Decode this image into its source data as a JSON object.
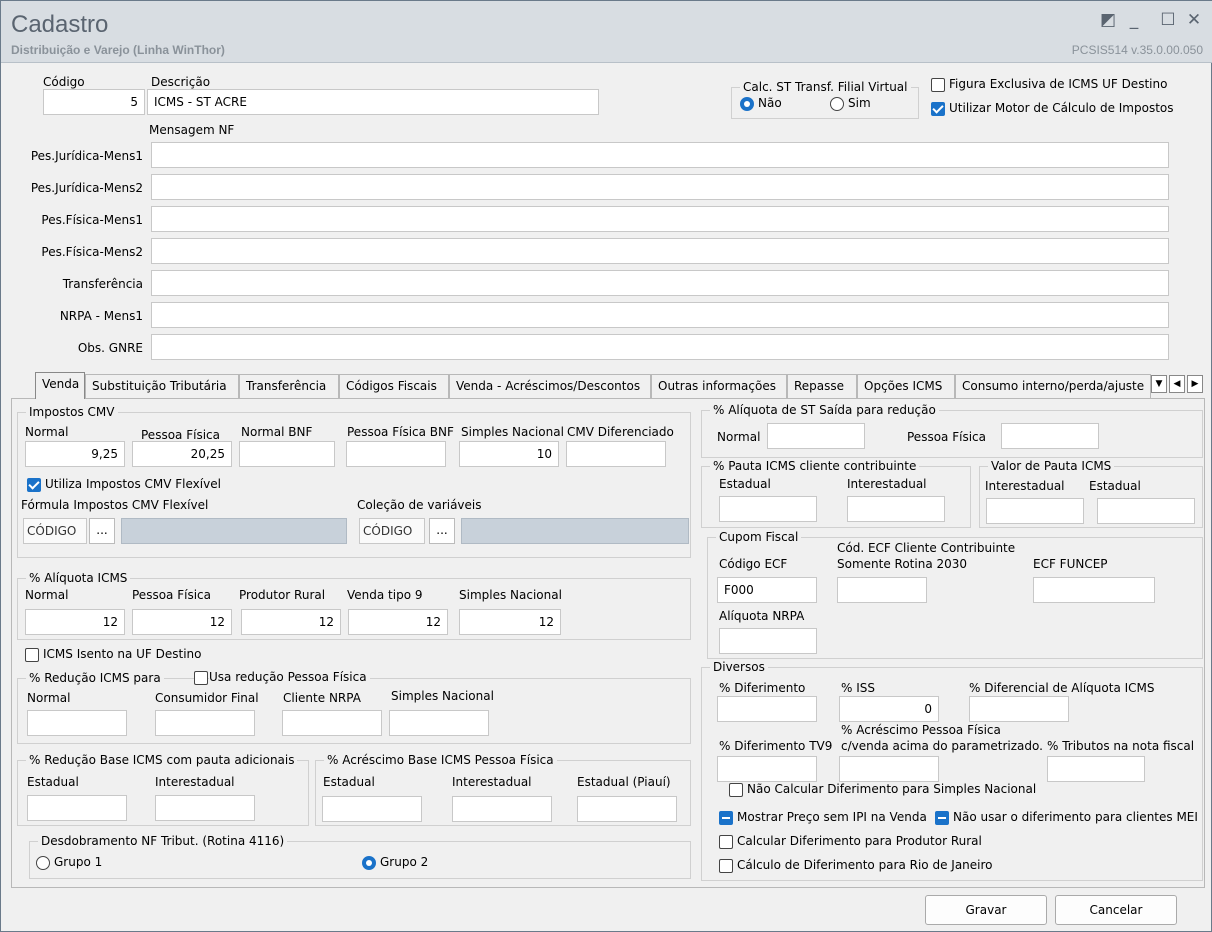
{
  "window": {
    "title": "Cadastro",
    "subtitle": "Distribuição e Varejo (Linha WinThor)",
    "version": "PCSIS514  v.35.0.00.050",
    "controls": {
      "restore": "◩",
      "minimize": "_",
      "maximize": "☐",
      "close": "✕"
    }
  },
  "header": {
    "codigo_label": "Código",
    "codigo_value": "5",
    "descricao_label": "Descrição",
    "descricao_value": "ICMS - ST ACRE",
    "calc_st_label": "Calc. ST Transf. Filial Virtual",
    "calc_st_nao": "Não",
    "calc_st_sim": "Sim",
    "calc_st_selected": "Não",
    "figura_exclusiva_label": "Figura Exclusiva de ICMS UF Destino",
    "figura_exclusiva_checked": false,
    "motor_calculo_label": "Utilizar Motor de Cálculo de Impostos",
    "motor_calculo_checked": true,
    "mensagem_nf_label": "Mensagem NF"
  },
  "messages": [
    {
      "label": "Pes.Jurídica-Mens1",
      "value": ""
    },
    {
      "label": "Pes.Jurídica-Mens2",
      "value": ""
    },
    {
      "label": "Pes.Física-Mens1",
      "value": ""
    },
    {
      "label": "Pes.Física-Mens2",
      "value": ""
    },
    {
      "label": "Transferência",
      "value": ""
    },
    {
      "label": "NRPA - Mens1",
      "value": ""
    },
    {
      "label": "Obs. GNRE",
      "value": ""
    }
  ],
  "tabs": [
    {
      "label": "Venda",
      "active": true
    },
    {
      "label": "Substituição Tributária"
    },
    {
      "label": "Transferência"
    },
    {
      "label": "Códigos Fiscais"
    },
    {
      "label": "Venda - Acréscimos/Descontos"
    },
    {
      "label": "Outras informações"
    },
    {
      "label": "Repasse"
    },
    {
      "label": "Opções ICMS"
    },
    {
      "label": "Consumo interno/perda/ajuste"
    }
  ],
  "tabnav": {
    "down": "▼",
    "left": "◀",
    "right": "▶"
  },
  "impostos_cmv": {
    "title": "Impostos CMV",
    "fields": [
      {
        "label": "Normal",
        "value": "9,25"
      },
      {
        "label": "Pessoa Física",
        "value": "20,25"
      },
      {
        "label": "Normal BNF",
        "value": ""
      },
      {
        "label": "Pessoa Física BNF",
        "value": ""
      },
      {
        "label": "Simples Nacional",
        "value": "10"
      },
      {
        "label": "CMV Diferenciado",
        "value": ""
      }
    ],
    "utiliza_flexivel_label": "Utiliza Impostos CMV Flexível",
    "utiliza_flexivel_checked": true,
    "formula_label": "Fórmula Impostos CMV Flexível",
    "formula_codigo": "CÓDIGO",
    "colecao_label": "Coleção de variáveis",
    "colecao_codigo": "CÓDIGO",
    "ellipsis": "..."
  },
  "aliquota_icms": {
    "title": "% Alíquota ICMS",
    "fields": [
      {
        "label": "Normal",
        "value": "12"
      },
      {
        "label": "Pessoa Física",
        "value": "12"
      },
      {
        "label": "Produtor Rural",
        "value": "12"
      },
      {
        "label": "Venda tipo 9",
        "value": "12"
      },
      {
        "label": "Simples Nacional",
        "value": "12"
      }
    ]
  },
  "icms_isento_label": "ICMS Isento na UF Destino",
  "icms_isento_checked": false,
  "reducao_icms": {
    "title": "% Redução ICMS para",
    "usa_reducao_label": "Usa redução Pessoa Física",
    "usa_reducao_checked": false,
    "fields": [
      {
        "label": "Normal",
        "value": ""
      },
      {
        "label": "Consumidor Final",
        "value": ""
      },
      {
        "label": "Cliente NRPA",
        "value": ""
      },
      {
        "label": "Simples Nacional",
        "value": ""
      }
    ]
  },
  "reducao_base": {
    "title": "% Redução Base ICMS com pauta adicionais",
    "fields": [
      {
        "label": "Estadual",
        "value": ""
      },
      {
        "label": "Interestadual",
        "value": ""
      }
    ]
  },
  "acrescimo_base": {
    "title": "% Acréscimo Base ICMS Pessoa Física",
    "fields": [
      {
        "label": "Estadual",
        "value": ""
      },
      {
        "label": "Interestadual",
        "value": ""
      },
      {
        "label": "Estadual (Piauí)",
        "value": ""
      }
    ]
  },
  "desdobramento": {
    "title": "Desdobramento NF Tribut. (Rotina 4116)",
    "grupo1": "Grupo 1",
    "grupo2": "Grupo 2",
    "selected": "Grupo 2"
  },
  "aliquota_st": {
    "title": "% Alíquota de ST Saída para redução",
    "normal_label": "Normal",
    "normal_value": "",
    "pf_label": "Pessoa Física",
    "pf_value": ""
  },
  "pauta_contribuinte": {
    "title": "% Pauta ICMS cliente contribuinte",
    "estadual_label": "Estadual",
    "interestadual_label": "Interestadual"
  },
  "valor_pauta": {
    "title": "Valor de Pauta ICMS",
    "interestadual_label": "Interestadual",
    "estadual_label": "Estadual"
  },
  "cupom_fiscal": {
    "title": "Cupom Fiscal",
    "codigo_ecf_label": "Código ECF",
    "codigo_ecf_value": "F000",
    "cod_ecf_cliente_label1": "Cód. ECF Cliente Contribuinte",
    "cod_ecf_cliente_label2": "Somente Rotina 2030",
    "ecf_funcep_label": "ECF FUNCEP",
    "aliquota_nrpa_label": "Alíquota NRPA"
  },
  "diversos": {
    "title": "Diversos",
    "diferimento_label": "% Diferimento",
    "iss_label": "% ISS",
    "iss_value": "0",
    "diferencial_label": "% Diferencial de Alíquota ICMS",
    "acrescimo_pf_label1": "% Acréscimo Pessoa Física",
    "acrescimo_pf_label2": "c/venda acima do parametrizado.",
    "diferimento_tv9_label": "% Diferimento TV9",
    "tributos_label": "% Tributos na nota fiscal",
    "nao_calcular_label": "Não Calcular Diferimento para Simples Nacional",
    "mostrar_preco_label": "Mostrar Preço sem IPI na Venda",
    "nao_usar_diferimento_label": "Não usar o diferimento para clientes MEI",
    "calcular_produtor_label": "Calcular Diferimento para Produtor Rural",
    "calculo_rio_label": "Cálculo de Diferimento para Rio de Janeiro"
  },
  "footer": {
    "gravar": "Gravar",
    "cancelar": "Cancelar"
  }
}
